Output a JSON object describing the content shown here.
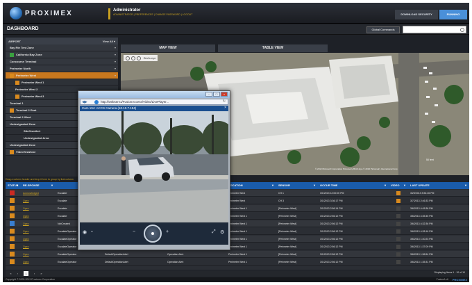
{
  "header": {
    "brand": "PROXIMEX",
    "role": "Administrator",
    "links": "ADMINISTRATOR | PREFERENCES | CHANGE PASSWORD | LOGOUT",
    "download_label": "DOWNLOAD SECURITY",
    "right_button": "RUNNING"
  },
  "dashboard": {
    "title": "DASHBOARD",
    "global_commands": "Global Commands",
    "search_placeholder": ""
  },
  "sidebar": {
    "title": "AIRPORT",
    "view_all": "View All ▾",
    "items": [
      {
        "label": "Bay Rte Tent Zone",
        "indent": 0,
        "color": ""
      },
      {
        "label": "California Bay Zone",
        "indent": 0,
        "color": "#3aa040"
      },
      {
        "label": "Concourse Terminal",
        "indent": 0,
        "color": ""
      },
      {
        "label": "Perimeter North",
        "indent": 0,
        "color": ""
      },
      {
        "label": "Perimeter West",
        "indent": 0,
        "color": "#d98a1e",
        "selected": true
      },
      {
        "label": "Perimeter West 1",
        "indent": 1,
        "color": "#d98a1e"
      },
      {
        "label": "Perimeter West 2",
        "indent": 1,
        "color": ""
      },
      {
        "label": "Perimeter West 3",
        "indent": 1,
        "color": "#d98a1e"
      },
      {
        "label": "Terminal 1",
        "indent": 0,
        "color": ""
      },
      {
        "label": "Terminal 2 East",
        "indent": 0,
        "color": "#d98a1e"
      },
      {
        "label": "Terminal 2 West",
        "indent": 0,
        "color": ""
      },
      {
        "label": "Undesignated Zone",
        "indent": 0,
        "color": ""
      },
      {
        "label": "SiteOneAlert",
        "indent": 2,
        "color": ""
      },
      {
        "label": "Undesignated Area",
        "indent": 2,
        "color": ""
      },
      {
        "label": "Undesignated Zone",
        "indent": 0,
        "color": ""
      },
      {
        "label": "VideoTestZone",
        "indent": 0,
        "color": "#d98a1e"
      }
    ]
  },
  "tabs": {
    "map": "MAP VIEW",
    "table": "TABLE VIEW"
  },
  "map": {
    "tool_label": "Bird's eye",
    "copyright": "© 2012 Microsoft Corporation  Pictometry Bird's Eye © 2010 Pictometry International Corp",
    "scale": "50 feet"
  },
  "tray_text": "Drag a column header and drop it here to group by that column",
  "table": {
    "headers": [
      "STATUS",
      "RE-SPONSE",
      "",
      "",
      "LOCATION",
      "SENSOR",
      "OCCUR TIME",
      "VIDEO",
      "LAST UPDATE"
    ],
    "rows": [
      {
        "sev": "#cc2a22",
        "status": "Acknowledged",
        "resp": "Escalate",
        "loc": "Perimeter West",
        "sensor": "CH 1",
        "time": "3/1/2013 12:00:00 PM",
        "video": "#d98a1e",
        "update": "3/29/2013 3:54:26 PM"
      },
      {
        "sev": "#d98a1e",
        "status": "Open",
        "resp": "Escalate",
        "loc": "Perimeter West",
        "sensor": "CH 3",
        "time": "3/1/2013 3:36:17 PM",
        "video": "#d98a1e",
        "update": "3/7/2013 2:46:33 PM"
      },
      {
        "sev": "#d98a1e",
        "status": "Open",
        "resp": "Escalate",
        "loc": "Perimeter West 1",
        "sensor": "[Perimeter West]",
        "time": "3/1/2013 2:56:14 PM",
        "video": "#444",
        "update": "3/6/2013 4:45:36 PM"
      },
      {
        "sev": "#d98a1e",
        "status": "Open",
        "resp": "Escalate",
        "loc": "Perimeter West 1",
        "sensor": "[Perimeter West]",
        "time": "3/1/2013 2:56:12 PM",
        "video": "#444",
        "update": "3/6/2013 4:35:45 PM"
      },
      {
        "sev": "#3a7fd0",
        "status": "Open",
        "resp": "NotCreated",
        "loc": "Perimeter West 1",
        "sensor": "[Perimeter West]",
        "time": "3/1/2013 2:56:12 PM",
        "video": "#444",
        "update": "3/6/2013 4:32:36 PM"
      },
      {
        "sev": "#d98a1e",
        "status": "Open",
        "resp": "EscalateOperator",
        "loc": "Perimeter West 1",
        "sensor": "[Perimeter West]",
        "time": "3/1/2013 2:56:12 PM",
        "video": "#444",
        "update": "3/6/2013 4:28:16 PM"
      },
      {
        "sev": "#d98a1e",
        "status": "Open",
        "resp": "EscalateOperator",
        "col3": "DefaultOperationAlert",
        "col4": "Operation Alert",
        "loc": "Perimeter West 1",
        "sensor": "[Perimeter West]",
        "time": "3/1/2013 2:56:12 PM",
        "video": "#444",
        "update": "3/6/2013 1:40:23 PM"
      },
      {
        "sev": "#d98a1e",
        "status": "Open",
        "resp": "EscalateOperator",
        "col3": "DefaultOperationAlert",
        "col4": "Operation Alert",
        "loc": "Perimeter West 1",
        "sensor": "[Perimeter West]",
        "time": "3/1/2013 2:56:12 PM",
        "video": "#444",
        "update": "3/6/2013 1:37:09 PM"
      },
      {
        "sev": "#d98a1e",
        "status": "Open",
        "resp": "EscalateOperator",
        "col3": "DefaultOperationAlert",
        "col4": "Operation Alert",
        "loc": "Perimeter West 1",
        "sensor": "[Perimeter West]",
        "time": "3/1/2013 2:56:12 PM",
        "video": "#444",
        "update": "3/6/2013 1:36:54 PM"
      },
      {
        "sev": "#d98a1e",
        "status": "Open",
        "resp": "EscalateOperator",
        "col3": "DefaultOperationAlert",
        "col4": "Operation Alert",
        "loc": "Perimeter West 1",
        "sensor": "[Perimeter West]",
        "time": "3/1/2013 2:56:12 PM",
        "video": "#444",
        "update": "3/6/2013 1:35:31 PM"
      }
    ]
  },
  "pager": {
    "current": "1",
    "display": "Displaying Items 1 - 10 of 10"
  },
  "footer": {
    "copyright": "Copyright © 2005-2013 Proximex Corporation",
    "version": "FusionA v6",
    "brand": "PROXIMEX"
  },
  "camera": {
    "url": "http://webserv1/FusionAccess/Video/LivePlayer...",
    "title": "Cam 194: ACCS Camera (10.10.7.194)"
  }
}
